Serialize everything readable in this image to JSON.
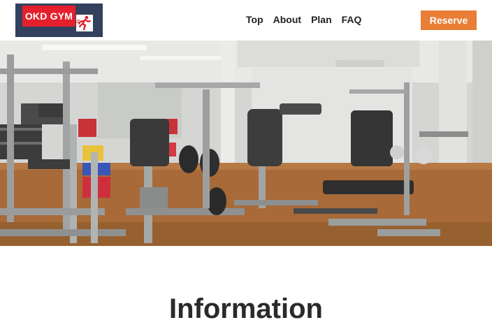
{
  "header": {
    "logo_text": "OKD GYM",
    "logo_icon": "running-person-icon",
    "nav": [
      {
        "label": "Top"
      },
      {
        "label": "About"
      },
      {
        "label": "Plan"
      },
      {
        "label": "FAQ"
      }
    ],
    "reserve_label": "Reserve"
  },
  "hero": {
    "image_subject": "gym interior with weight machines"
  },
  "main": {
    "section_title": "Information"
  },
  "colors": {
    "brand_navy": "#33415e",
    "brand_red": "#e4202c",
    "accent_orange": "#e97e36",
    "floor_wood": "#a86a38"
  }
}
